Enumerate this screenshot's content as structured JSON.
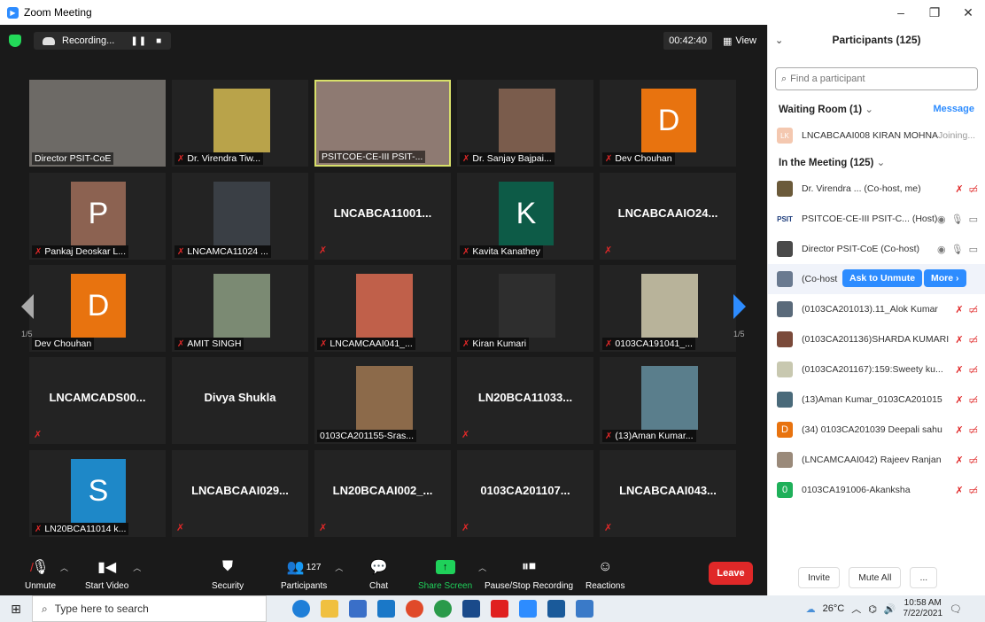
{
  "window": {
    "title": "Zoom Meeting",
    "minimize": "–",
    "restore": "❐",
    "close": "✕"
  },
  "topbar": {
    "recording_label": "Recording...",
    "pause_icon": "❚❚",
    "stop_icon": "■",
    "timer": "00:42:40",
    "view_label": "View"
  },
  "tiles": [
    {
      "type": "photo",
      "name": "Director PSIT-CoE",
      "muted": false,
      "color": "#6d6a66"
    },
    {
      "type": "photo",
      "name": "Dr. Virendra Tiw...",
      "muted": true,
      "color": "#b9a34a"
    },
    {
      "type": "photo",
      "name": "PSITCOE-CE-III PSIT-...",
      "muted": false,
      "color": "#8e7a72",
      "active": true
    },
    {
      "type": "photo",
      "name": "Dr. Sanjay Bajpai...",
      "muted": true,
      "color": "#7a5c4c"
    },
    {
      "type": "letter",
      "letter": "D",
      "name": "Dev Chouhan",
      "muted": true,
      "color": "#e8730f"
    },
    {
      "type": "letter",
      "letter": "P",
      "name": "Pankaj Deoskar L...",
      "muted": true,
      "color": "#8c6251"
    },
    {
      "type": "photo",
      "name": "LNCAMCA11024 ...",
      "muted": true,
      "color": "#3a3f45"
    },
    {
      "type": "text",
      "text": "LNCABCA11001...",
      "muted": true
    },
    {
      "type": "letter",
      "letter": "K",
      "name": "Kavita Kanathey",
      "muted": true,
      "color": "#0d5b47"
    },
    {
      "type": "text",
      "text": "LNCABCAAIO24...",
      "muted": true
    },
    {
      "type": "letter",
      "letter": "D",
      "name": "Dev Chouhan",
      "muted": false,
      "color": "#e8730f"
    },
    {
      "type": "photo",
      "name": "AMIT SINGH",
      "muted": true,
      "color": "#7b8a73"
    },
    {
      "type": "photo",
      "name": "LNCAMCAAI041_...",
      "muted": true,
      "color": "#c0604a"
    },
    {
      "type": "photo",
      "name": "Kiran Kumari",
      "muted": true,
      "color": "#2e2e2e"
    },
    {
      "type": "photo",
      "name": "0103CA191041_...",
      "muted": true,
      "color": "#b8b39a"
    },
    {
      "type": "text",
      "text": "LNCAMCADS00...",
      "muted": true
    },
    {
      "type": "text",
      "text": "Divya Shukla",
      "muted": false
    },
    {
      "type": "photo",
      "name": "0103CA201155-Sras...",
      "muted": false,
      "color": "#8c6a4a"
    },
    {
      "type": "text",
      "text": "LN20BCA11033...",
      "muted": true
    },
    {
      "type": "photo",
      "name": "(13)Aman Kumar...",
      "muted": true,
      "color": "#5a7e8c"
    },
    {
      "type": "letter",
      "letter": "S",
      "name": "LN20BCA11014 k...",
      "muted": true,
      "color": "#1e88c8"
    },
    {
      "type": "text",
      "text": "LNCABCAAI029...",
      "muted": true
    },
    {
      "type": "text",
      "text": "LN20BCAAI002_...",
      "muted": true
    },
    {
      "type": "text",
      "text": "0103CA201107...",
      "muted": true
    },
    {
      "type": "text",
      "text": "LNCABCAAI043...",
      "muted": true
    }
  ],
  "pages": {
    "left": "1/5",
    "right": "1/5"
  },
  "toolbar": {
    "unmute": "Unmute",
    "start_video": "Start Video",
    "security": "Security",
    "participants": "Participants",
    "participants_count": "127",
    "chat": "Chat",
    "share_screen": "Share Screen",
    "pause_recording": "Pause/Stop Recording",
    "reactions": "Reactions",
    "leave": "Leave"
  },
  "panel": {
    "title": "Participants (125)",
    "search_placeholder": "Find a participant",
    "waiting_room": "Waiting Room (1)",
    "message": "Message",
    "waiting": [
      {
        "initials": "LK",
        "name": "LNCABCAAI008 KIRAN MOHNA",
        "status": "Joining..."
      }
    ],
    "in_meeting": "In the Meeting (125)",
    "participants": [
      {
        "name": "Dr. Virendra ... (Co-host, me)",
        "av": "#6b5a3a",
        "icons": "red"
      },
      {
        "name": "PSITCOE-CE-III PSIT-C... (Host)",
        "av": "#ffffff",
        "logo": "PSIT",
        "icons": "gray"
      },
      {
        "name": "Director PSIT-CoE (Co-host)",
        "av": "#4a4a4a",
        "icons": "gray"
      },
      {
        "name": "(Co-host",
        "av": "#6a7a90",
        "icons": "hover"
      },
      {
        "name": "(0103CA201013).11_Alok Kumar",
        "av": "#5a6a7a",
        "icons": "red"
      },
      {
        "name": "(0103CA201136)SHARDA KUMARI",
        "av": "#7a4a3a",
        "icons": "red"
      },
      {
        "name": "(0103CA201167):159:Sweety ku...",
        "av": "#c8c8b0",
        "icons": "red"
      },
      {
        "name": "(13)Aman Kumar_0103CA201015",
        "av": "#4a6a7a",
        "icons": "red"
      },
      {
        "name": "(34) 0103CA201039 Deepali sahu",
        "av": "#e8730f",
        "letter": "D",
        "icons": "red"
      },
      {
        "name": "(LNCAMCAAI042) Rajeev Ranjan",
        "av": "#9a8a7a",
        "icons": "red"
      },
      {
        "name": "0103CA191006-Akanksha",
        "av": "#1fb05a",
        "letter": "0",
        "icons": "red"
      }
    ],
    "ask_to_unmute": "Ask to Unmute",
    "more": "More ›",
    "invite": "Invite",
    "mute_all": "Mute All",
    "more_dots": "..."
  },
  "taskbar": {
    "search_placeholder": "Type here to search",
    "weather": "26°C",
    "time": "10:58 AM",
    "date": "7/22/2021"
  },
  "colors": {
    "zoom_blue": "#2D8CFF",
    "mute_red": "#E02828",
    "share_green": "#1FD15A",
    "active_border": "#D8E06A"
  }
}
